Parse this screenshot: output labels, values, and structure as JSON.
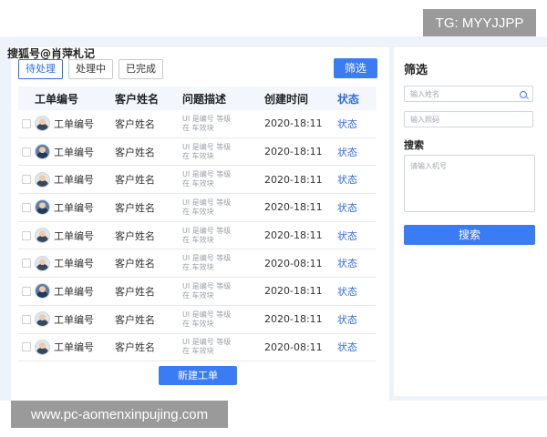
{
  "watermarks": {
    "top_right": "TG: MYYJJPP",
    "bottom_left": "www.pc-aomenxinpujing.com",
    "source": "搜狐号@肖萍札记"
  },
  "tabs": [
    {
      "label": "待处理",
      "active": true
    },
    {
      "label": "处理中",
      "active": false
    },
    {
      "label": "已完成",
      "active": false
    }
  ],
  "toolbar": {
    "filter_label": "筛选"
  },
  "table": {
    "headers": [
      "工单编号",
      "客户姓名",
      "问题描述",
      "创建时间",
      "状态"
    ],
    "rows": [
      {
        "id": "工单编号",
        "name": "客户姓名",
        "desc_line1": "UI 是编号 等级",
        "desc_line2": "在 车效块",
        "time": "2020-18:11",
        "status": "状态"
      },
      {
        "id": "工单编号",
        "name": "客户姓名",
        "desc_line1": "UI 是编号 等级",
        "desc_line2": "在 车效块",
        "time": "2020-18:11",
        "status": "状态"
      },
      {
        "id": "工单编号",
        "name": "客户姓名",
        "desc_line1": "UI 是编号 等级",
        "desc_line2": "在 车效块",
        "time": "2020-18:11",
        "status": "状态"
      },
      {
        "id": "工单编号",
        "name": "客户姓名",
        "desc_line1": "UI 是编号 等级",
        "desc_line2": "在 车效块",
        "time": "2020-18:11",
        "status": "状态"
      },
      {
        "id": "工单编号",
        "name": "客户姓名",
        "desc_line1": "UI 是编号 等级",
        "desc_line2": "在 车效块",
        "time": "2020-18:11",
        "status": "状态"
      },
      {
        "id": "工单编号",
        "name": "客户姓名",
        "desc_line1": "UI 是编号 等级",
        "desc_line2": "在 车效块",
        "time": "2020-08:11",
        "status": "状态"
      },
      {
        "id": "工单编号",
        "name": "客户姓名",
        "desc_line1": "UI 是编号 等级",
        "desc_line2": "在 车效块",
        "time": "2020-18:11",
        "status": "状态"
      },
      {
        "id": "工单编号",
        "name": "客户姓名",
        "desc_line1": "UI 是编号 等级",
        "desc_line2": "在 车效块",
        "time": "2020-18:11",
        "status": "状态"
      },
      {
        "id": "工单编号",
        "name": "客户姓名",
        "desc_line1": "UI 是编号 等级",
        "desc_line2": "在 车效块",
        "time": "2020-08:11",
        "status": "状态"
      }
    ]
  },
  "actions": {
    "new_ticket": "新建工单"
  },
  "filter_panel": {
    "title": "筛选",
    "name_placeholder": "输入姓名",
    "id_placeholder": "输入照码",
    "search_label": "搜索",
    "phone_placeholder": "请输入机号",
    "search_button": "搜索"
  },
  "colors": {
    "accent": "#3b7cf4",
    "page_bg": "#eef3fa"
  }
}
